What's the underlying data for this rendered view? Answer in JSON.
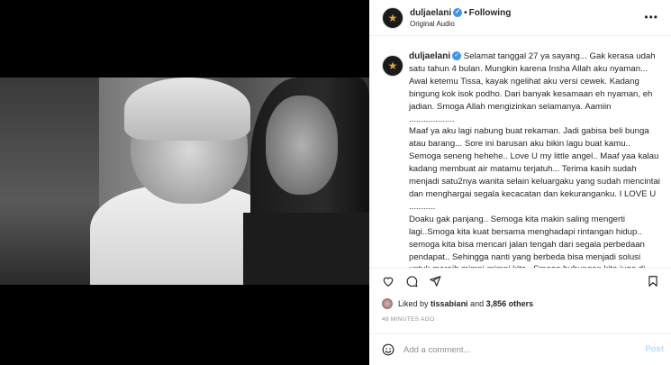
{
  "post": {
    "username": "duljaelani",
    "separator": "•",
    "follow_label": "Following",
    "audio_label": "Original Audio",
    "more_icon": "more-horizontal-icon"
  },
  "caption": {
    "username": "duljaelani",
    "paragraphs": [
      "Selamat tanggal 27 ya sayang... Gak kerasa udah satu tahun 4 bulan. Mungkin karena Insha Allah aku nyaman... Awal ketemu Tissa, kayak ngelihat aku versi cewek. Kadang bingung kok isok podho. Dari banyak kesamaan eh nyaman, eh jadian. Smoga Allah mengizinkan selamanya. Aamiin\n...................",
      "Maaf ya aku lagi nabung buat rekaman. Jadi gabisa beli bunga atau barang... Sore ini barusan aku bikin lagu buat kamu.. Semoga seneng hehehe.. Love U my little angel.. Maaf yaa kalau kadang membuat air matamu terjatuh... Terima kasih sudah menjadi satu2nya wanita selain keluargaku yang sudah mencintai dan menghargai segala kecacatan dan kekuranganku. I LOVE U\n...........",
      "Doaku gak panjang.. Semoga kita makin saling mengerti lagi..Smoga kita kuat bersama menghadapi rintangan hidup.. semoga kita bisa mencari jalan tengah dari segala perbedaan pendapat.. Sehingga nanti yang berbeda bisa menjadi solusi untuk meraih mimpi-mimpi kita.. Smoga hubungan kita juga di Ridhoi Allah.... Kamu wanita yang jiwanya paling indah yg pernah aku"
    ]
  },
  "likes": {
    "prefix": "Liked by",
    "user": "tissabiani",
    "middle": "and",
    "count": "3,856 others"
  },
  "timestamp": "48 MINUTES AGO",
  "comment": {
    "placeholder": "Add a comment...",
    "post_label": "Post"
  },
  "colors": {
    "verified": "#3897f0",
    "post_button": "#b2dffc",
    "muted_text": "#8e8e8e"
  }
}
